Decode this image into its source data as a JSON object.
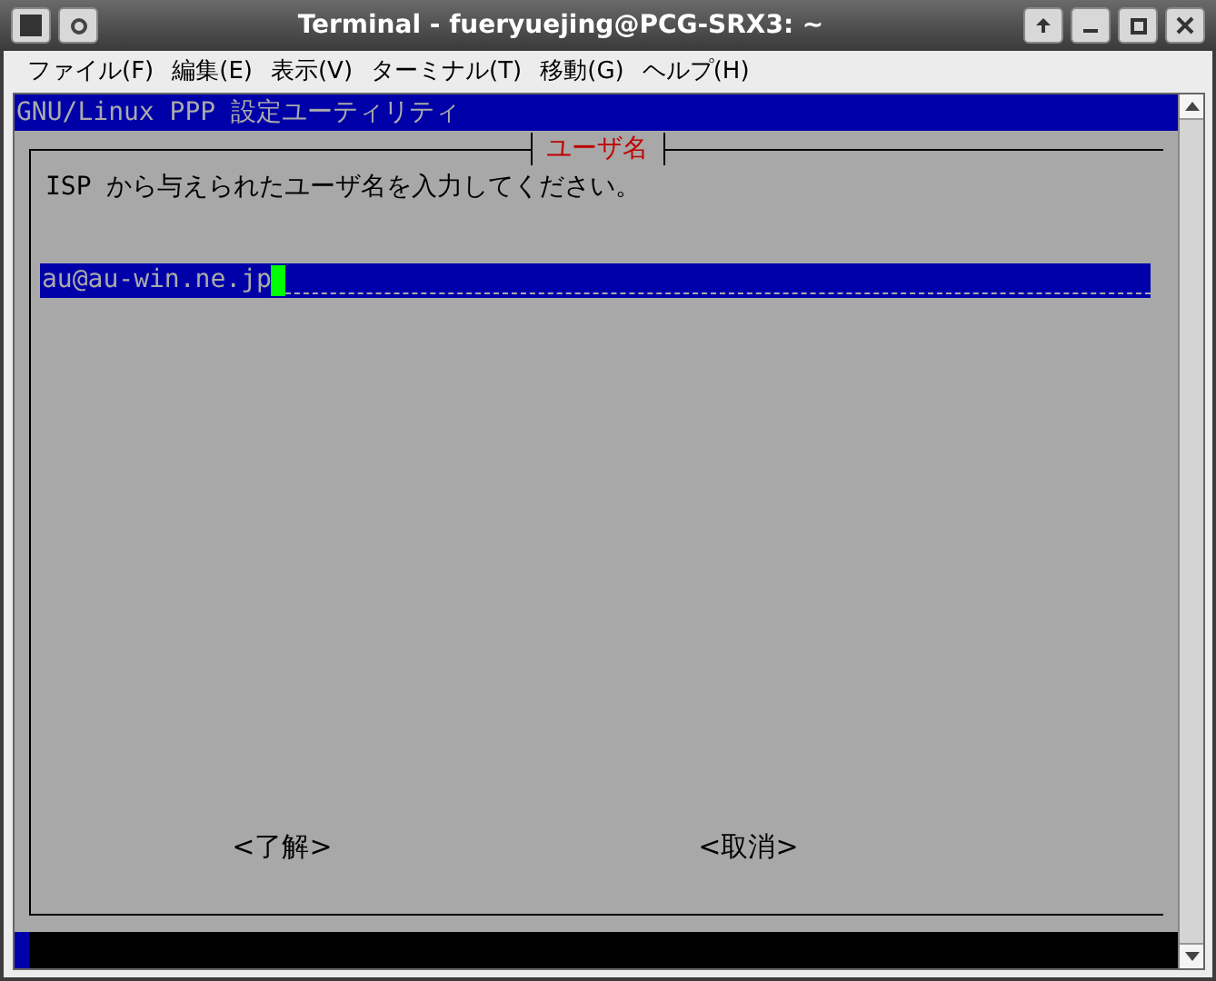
{
  "window": {
    "title": "Terminal - fueryuejing@PCG-SRX3: ~"
  },
  "menu": [
    "ファイル(F)",
    "編集(E)",
    "表示(V)",
    "ターミナル(T)",
    "移動(G)",
    "ヘルプ(H)"
  ],
  "terminal": {
    "header": "GNU/Linux PPP 設定ユーティリティ",
    "dialog": {
      "title": "ユーザ名",
      "prompt": "ISP から与えられたユーザ名を入力してください。",
      "field": {
        "value": "au@au-win.ne.jp"
      },
      "buttons": [
        {
          "label": "<了解>"
        },
        {
          "label": "<取消>"
        }
      ]
    }
  }
}
